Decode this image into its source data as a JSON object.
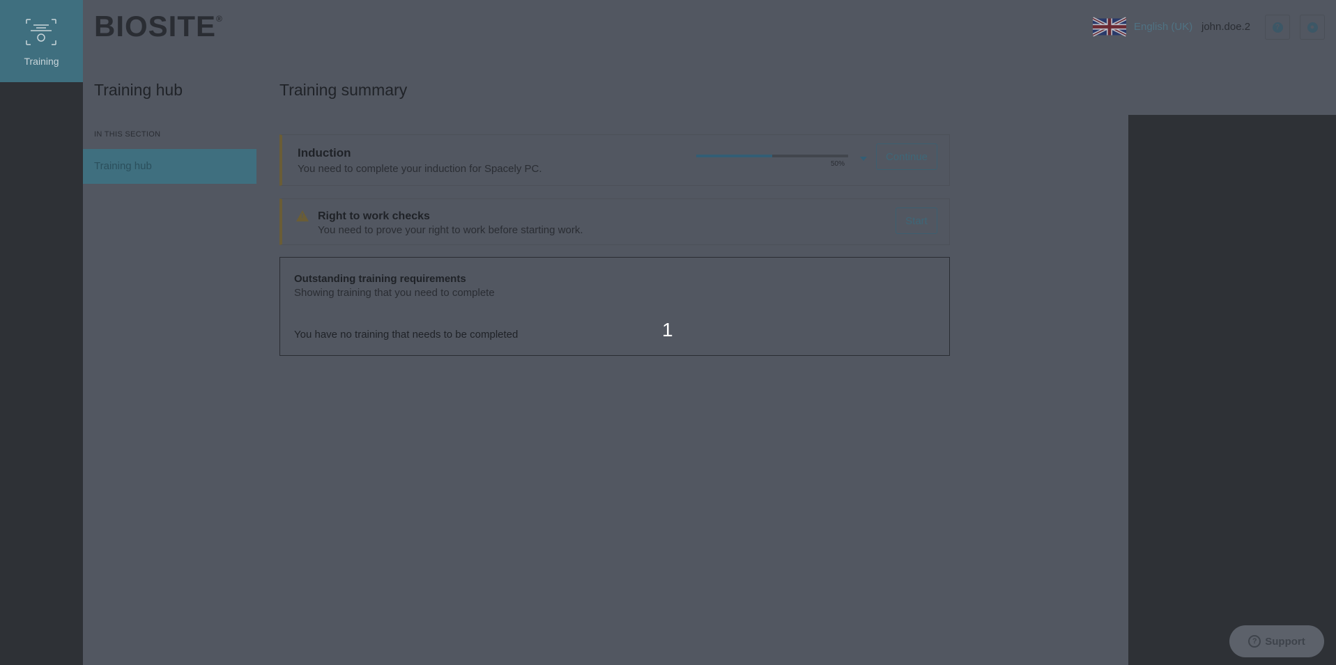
{
  "app": {
    "module_label": "Training",
    "logo_text": "BIOSITE",
    "logo_mark": "®"
  },
  "header": {
    "language": "English (UK)",
    "username": "john.doe.2",
    "help_icon": "question-circle-icon",
    "profile_icon": "user-circle-icon"
  },
  "sidebar": {
    "title": "Training hub",
    "section_label": "IN THIS SECTION",
    "items": [
      {
        "label": "Training hub",
        "active": true
      }
    ]
  },
  "main": {
    "title": "Training summary",
    "induction": {
      "title": "Induction",
      "description": "You need to complete your induction for Spacely PC.",
      "progress": 0.5,
      "progress_label": "50%",
      "button_label": "Continue"
    },
    "right_to_work": {
      "title": "Right to work checks",
      "description": "You need to prove your right to work before starting work.",
      "button_label": "Start",
      "icon": "warning-icon"
    },
    "outstanding": {
      "title": "Outstanding training requirements",
      "subtitle": "Showing training that you need to complete",
      "empty_message": "You have no training that needs to be completed"
    },
    "overlay_marker": "1"
  },
  "support": {
    "label": "Support"
  },
  "colors": {
    "overlay": "#525761",
    "accent": "#3f6f7f",
    "warning": "#6a5d36"
  }
}
